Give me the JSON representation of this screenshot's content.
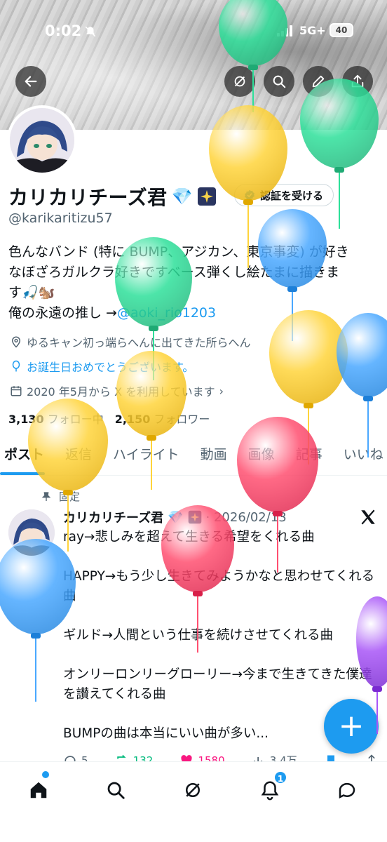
{
  "status": {
    "time": "0:02",
    "network": "5G+",
    "battery": "40"
  },
  "profile": {
    "display_name": "カリカリチーズ君",
    "name_emojis": "💎",
    "handle": "@karikaritizu57",
    "verify_label": "認証を受ける",
    "bio_line1": "色んなバンド (特に BUMP、アジカン、東京事変) が好き",
    "bio_line2": "なぼざろガルクラ好きですベース弾くし絵たまに描きま",
    "bio_line3": "す🎣🐿️",
    "bio_line4_prefix": "俺の永遠の推し →",
    "bio_mention": "@aoki_rio1203",
    "location": "ゆるキャン初っ端らへんに出てきた所らへん",
    "birthday_text": "お誕生日おめでとうございます。",
    "joined": "2020 年5月から X を利用しています",
    "following_count": "3,130",
    "following_label": "フォロー中",
    "followers_count": "2,150",
    "followers_label": "フォロワー"
  },
  "tabs": [
    "ポスト",
    "返信",
    "ハイライト",
    "動画",
    "画像",
    "記事",
    "いいね"
  ],
  "pinned_post": {
    "pinned_label": "固定",
    "author": "カリカリチーズ君",
    "date": "· 2026/02/13",
    "body": "ray→悲しみを超えて生きる希望をくれる曲\n\nHAPPY→もう少し生きてみようかなと思わせてくれる曲\n\nギルド→人間という仕事を続けさせてくれる曲\n\nオンリーロンリーグローリー→今まで生きてきた僕達を讃えてくれる曲\n\nBUMPの曲は本当にいい曲が多い...",
    "replies": "5",
    "reposts": "132",
    "likes": "1580",
    "views": "3.4万"
  },
  "fab_label": "+",
  "nav": {
    "notification_count": "1"
  },
  "colors": {
    "accent": "#1d9bf0",
    "repost": "#00ba7c",
    "like": "#f91880"
  }
}
